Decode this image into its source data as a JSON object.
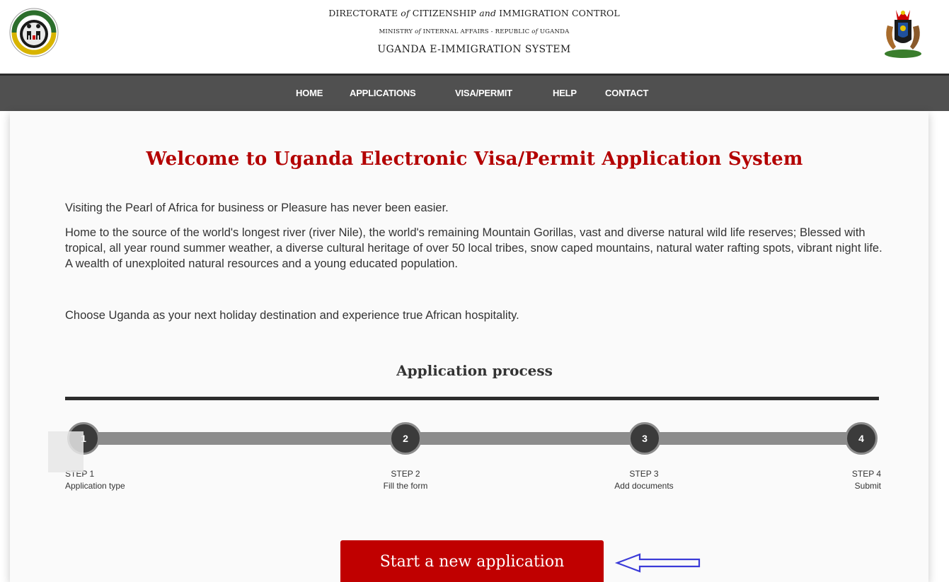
{
  "header": {
    "line1_a": "DIRECTORATE ",
    "line1_b": "of",
    "line1_c": " CITIZENSHIP ",
    "line1_d": "and",
    "line1_e": " IMMIGRATION CONTROL",
    "line2_a": "MINISTRY ",
    "line2_b": "of",
    "line2_c": " INTERNAL AFFAIRS - REPUBLIC ",
    "line2_d": "of",
    "line2_e": " UGANDA",
    "line3": "UGANDA E-IMMIGRATION SYSTEM",
    "left_logo_icon": "immigration-uganda-logo",
    "right_logo_icon": "uganda-coat-of-arms"
  },
  "nav": {
    "items": [
      {
        "label": "HOME"
      },
      {
        "label": "APPLICATIONS"
      },
      {
        "label": "VISA/PERMIT"
      },
      {
        "label": "HELP"
      },
      {
        "label": "CONTACT"
      }
    ]
  },
  "main": {
    "welcome": "Welcome to Uganda Electronic Visa/Permit Application System",
    "paragraphs": [
      "Visiting the Pearl of Africa for business or Pleasure has never been easier.",
      "Home to the source of the world's longest river (river Nile), the world's remaining Mountain Gorillas, vast and diverse natural wild life reserves; Blessed with tropical, all year round summer weather, a diverse cultural heritage of over 50 local tribes, snow caped mountains, natural water rafting spots, vibrant night life. A wealth of unexploited natural resources and a young educated population.",
      "Choose Uganda as your next holiday destination and experience true African hospitality."
    ],
    "process_title": "Application process",
    "steps": [
      {
        "number": "1",
        "step": "STEP 1",
        "desc": "Application type"
      },
      {
        "number": "2",
        "step": "STEP 2",
        "desc": "Fill the form"
      },
      {
        "number": "3",
        "step": "STEP 3",
        "desc": "Add documents"
      },
      {
        "number": "4",
        "step": "STEP 4",
        "desc": "Submit"
      }
    ],
    "start_button": "Start a new application"
  },
  "colors": {
    "accent_red": "#b30000",
    "button_red": "#c00000",
    "nav_bg": "#505050",
    "step_circle": "#3b3b3b",
    "arrow": "#3b3bd8"
  }
}
